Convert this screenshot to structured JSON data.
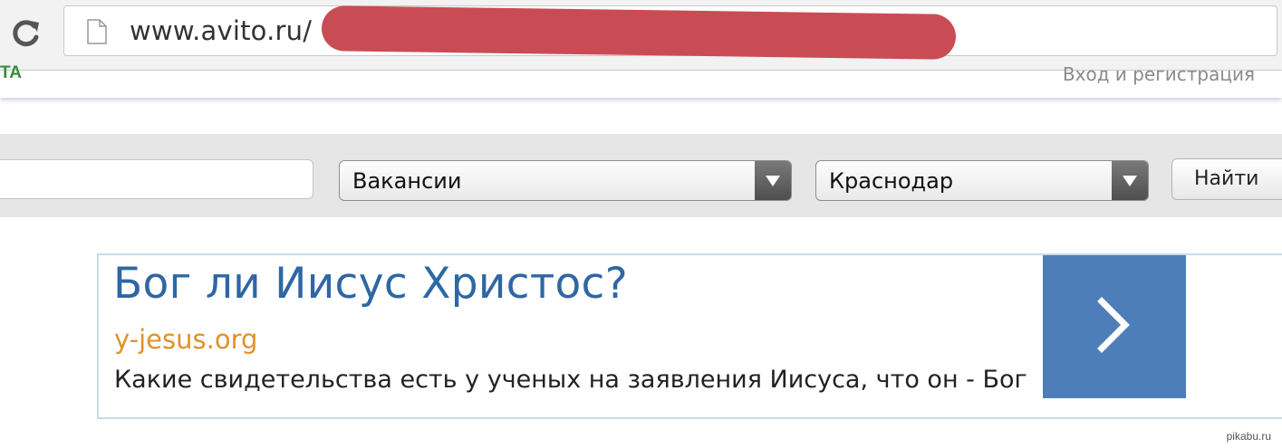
{
  "browser": {
    "url": "www.avito.ru/"
  },
  "site": {
    "top_left_fragment": "TA",
    "login_link": "Вход и регистрация"
  },
  "search": {
    "category_selected": "Вакансии",
    "city_selected": "Краснодар",
    "find_label": "Найти"
  },
  "ad": {
    "title": "Бог ли Иисус Христос?",
    "domain": "y-jesus.org",
    "description": "Какие свидетельства есть у ученых на заявления Иисуса, что он - Бог"
  },
  "watermark": "pikabu.ru",
  "colors": {
    "redaction": "#c94c55",
    "ad_title": "#2e67a3",
    "ad_domain": "#e0922a",
    "ad_arrow_box": "#4d7eb9"
  },
  "icons": {
    "reload": "reload-icon",
    "page": "page-icon",
    "dropdown": "triangle-down-icon",
    "ad_arrow": "chevron-right-icon"
  }
}
